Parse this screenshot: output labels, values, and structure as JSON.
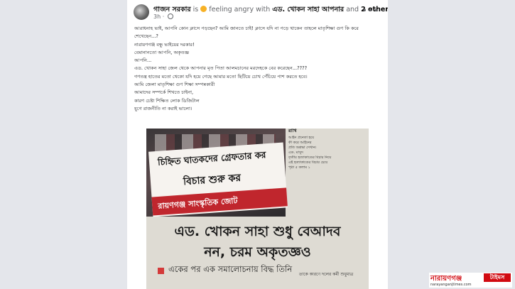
{
  "post": {
    "author": "গাজন সরকার",
    "is_label": "is",
    "feeling": "feeling angry with",
    "tagged": "এড. খোকন সাহা আপনার",
    "and_label": "and",
    "others": "2 others.",
    "time": "3h",
    "more_label": "•••",
    "lines": [
      "আরাধনাহ ভাই, আপনি কোন ক্লাসে পড়ছেন? আমি জানতে চাই! ক্লাসে যদি না পড়ে থাকেন তাহলে মাতৃশিক্ষা গুণ কি করে",
      "শেখেছেন...?",
      "নারায়ণগঞ্জ বন্ধু ভাইয়ের দরকার!",
      "বেমানানতো আপনি, অকৃতজ্ঞ",
      "আপনি...",
      "এড. খোকন সাহা জেল থেকে আপনার মৃত পিতা আলমচানের মরদেহকে বের করেছেন...????",
      "গণতন্ত্র হাতের মতো থেকো যদি হয়ে গেছে আমার মতো ছিটিয়ে চোখ পেঁচিয়ে পাশ করতে হবে।",
      "আমি জেলা মাতৃশিক্ষা গুণ শিক্ষা সম্পন্নকারী",
      "আমাদের সম্পর্কে শিখতে চাইনা,",
      "কারণ চেষ্টা শিক্ষিত লোক ডিজিটাল",
      "যুগে রাজনীতি না করাই ভালো।"
    ]
  },
  "photo": {
    "banner_line1": "চিহ্নিত ঘাতকদের গ্রেফতার কর",
    "banner_line2": "বিচার শুরু কর",
    "banner_org": "রায়ণগঞ্জ সাংস্কৃতিক জোট",
    "side_head": "রাখি",
    "side_snippets": [
      "আইন প্রনেতা হয়ে",
      "কী করে আইনের",
      "প্রতি অশ্রদ্ধা দেখান।",
      "এড. মাসুদ",
      "তৃতীয় হত্যাকাণ্ডের বিচার নিয়ে",
      "এই হত্যাকাণ্ডের বিচার চেয়ে",
      "পৃষ্ঠা ৫ কলাম ১"
    ],
    "headline_line1": "এড. খোকন সাহা শুধু বেআদব",
    "headline_line2": "নন, চরম অকৃতজ্ঞও",
    "subhead": "একের পর এক সমালোচনায় বিদ্ধ তিনি",
    "bottom_snippet": "তাকে কারণে দলের কর্মী শুধুমাত্র"
  },
  "watermark": {
    "name": "নারায়ণগঞ্জ",
    "badge": "টাইমস",
    "url": "narayanganjtimes.com"
  },
  "colors": {
    "brand_red": "#d10a11",
    "banner_red": "#c0262d",
    "page_bg": "#e4e6eb"
  },
  "icons": {
    "emoji": "angry-face-icon",
    "privacy": "globe-icon"
  }
}
